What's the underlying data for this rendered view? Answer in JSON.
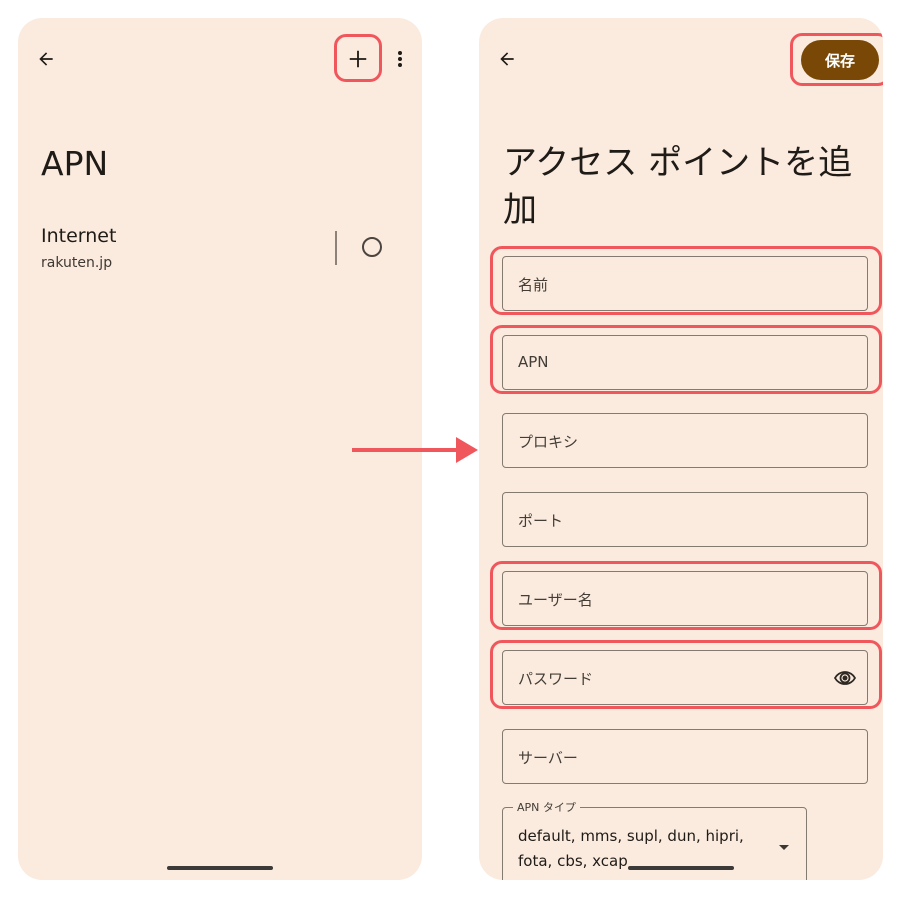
{
  "left_screen": {
    "title": "APN",
    "apn_item": {
      "name": "Internet",
      "sub": "rakuten.jp"
    }
  },
  "right_screen": {
    "save_label": "保存",
    "title": "アクセス ポイントを追加",
    "fields": {
      "name": "名前",
      "apn": "APN",
      "proxy": "プロキシ",
      "port": "ポート",
      "username": "ユーザー名",
      "password": "パスワード",
      "server": "サーバー"
    },
    "apn_type": {
      "label": "APN タイプ",
      "value": "default, mms, supl, dun, hipri, fota, cbs, xcap"
    }
  },
  "icons": [
    "back-arrow-icon",
    "plus-icon",
    "more-vert-icon",
    "eye-icon",
    "dropdown-caret-icon"
  ],
  "colors": {
    "background": "#fbebdf",
    "highlight": "#f0575d",
    "save_button": "#7a4806",
    "arrow": "#f0575d"
  }
}
